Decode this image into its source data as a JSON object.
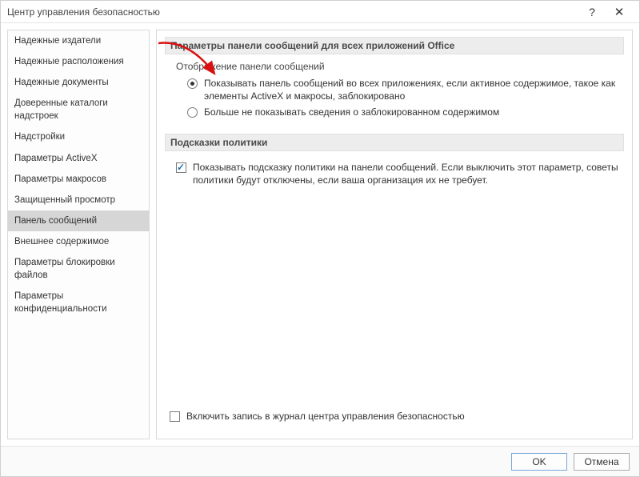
{
  "titlebar": {
    "title": "Центр управления безопасностью",
    "help_icon": "?",
    "close_icon": "✕"
  },
  "sidebar": {
    "items": [
      {
        "label": "Надежные издатели"
      },
      {
        "label": "Надежные расположения"
      },
      {
        "label": "Надежные документы"
      },
      {
        "label": "Доверенные каталоги надстроек"
      },
      {
        "label": "Надстройки"
      },
      {
        "label": "Параметры ActiveX"
      },
      {
        "label": "Параметры макросов"
      },
      {
        "label": "Защищенный просмотр"
      },
      {
        "label": "Панель сообщений",
        "selected": true
      },
      {
        "label": "Внешнее содержимое"
      },
      {
        "label": "Параметры блокировки файлов"
      },
      {
        "label": "Параметры конфиденциальности"
      }
    ]
  },
  "content": {
    "group1_header": "Параметры панели сообщений для всех приложений Office",
    "group1_sub": "Отображение панели сообщений",
    "radio_show": "Показывать панель сообщений во всех приложениях, если активное содержимое, такое как элементы ActiveX и макросы, заблокировано",
    "radio_hide": "Больше не показывать сведения о заблокированном содержимом",
    "group2_header": "Подсказки политики",
    "check_policy": "Показывать подсказку политики на панели сообщений. Если выключить этот параметр, советы политики будут отключены, если ваша организация их не требует.",
    "check_log": "Включить запись в журнал центра управления безопасностью"
  },
  "footer": {
    "ok": "OK",
    "cancel": "Отмена"
  }
}
